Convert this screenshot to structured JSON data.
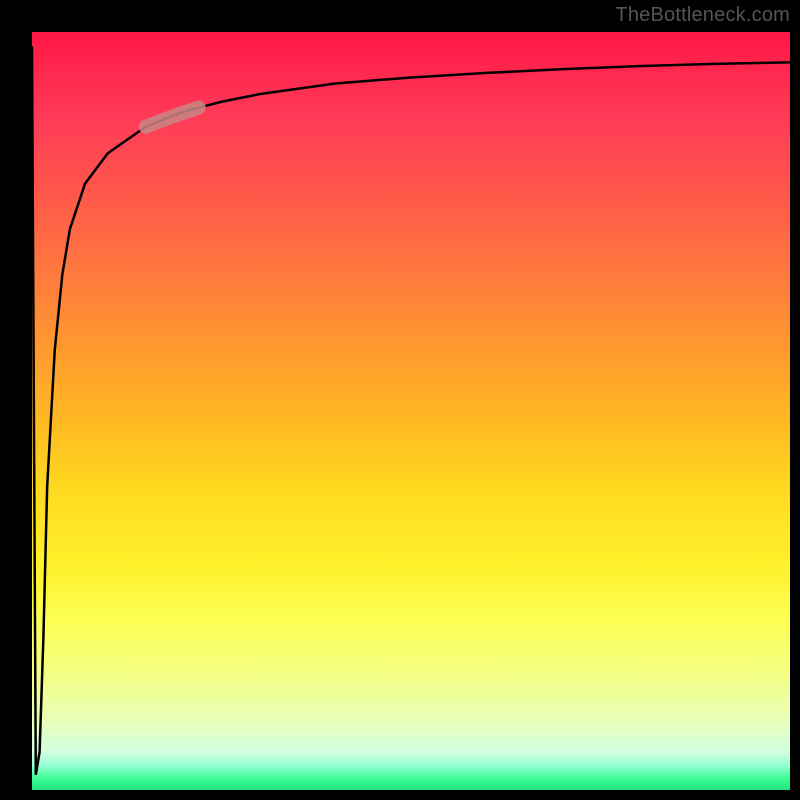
{
  "watermark": "TheBottleneck.com",
  "chart_data": {
    "type": "line",
    "title": "",
    "xlabel": "",
    "ylabel": "",
    "xlim": [
      0,
      100
    ],
    "ylim": [
      0,
      100
    ],
    "background_gradient": {
      "top_color": "#ff1744",
      "mid_color": "#ffd81f",
      "bottom_color": "#23e47f",
      "description": "vertical red-to-yellow-to-green gradient"
    },
    "series": [
      {
        "name": "bottleneck-curve",
        "color": "#000000",
        "x": [
          0,
          0.5,
          1,
          1.5,
          2,
          3,
          4,
          5,
          7,
          10,
          15,
          20,
          25,
          30,
          40,
          50,
          60,
          70,
          80,
          90,
          100
        ],
        "y": [
          98,
          2,
          5,
          20,
          40,
          58,
          68,
          74,
          80,
          84,
          87.5,
          89.5,
          90.8,
          91.8,
          93.2,
          94.0,
          94.6,
          95.1,
          95.5,
          95.8,
          96.0
        ]
      }
    ],
    "highlight_segment": {
      "color": "#c98686",
      "opacity": 0.85,
      "x_range": [
        15,
        22
      ],
      "y_range": [
        84,
        87
      ],
      "description": "short thick pink overlay near upper-left portion of curve"
    },
    "notes": "Y-axis values represent height as percentage from bottom of plot; no numeric axis ticks are shown in the image."
  }
}
